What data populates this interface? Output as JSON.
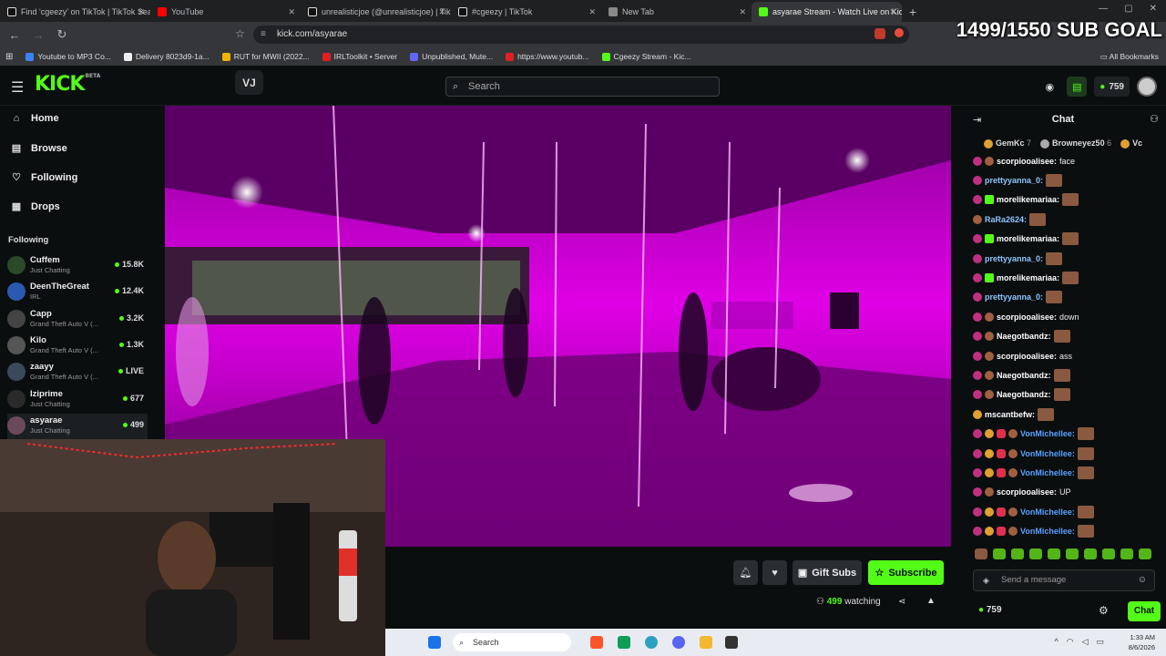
{
  "browser": {
    "tabs": [
      {
        "title": "Find 'cgeezy' on TikTok | TikTok Search",
        "icon": "tiktok-icon"
      },
      {
        "title": "YouTube",
        "icon": "youtube-icon"
      },
      {
        "title": "unrealisticjoe (@unrealisticjoe) | TikTok",
        "icon": "tiktok-icon"
      },
      {
        "title": "#cgeezy | TikTok",
        "icon": "tiktok-icon"
      },
      {
        "title": "New Tab",
        "icon": "chrome-icon"
      },
      {
        "title": "asyarae Stream - Watch Live on Kick",
        "icon": "kick-icon"
      }
    ],
    "url": "kick.com/asyarae",
    "bookmarks": [
      {
        "label": "Youtube to MP3 Co...",
        "color": "#3b82f6"
      },
      {
        "label": "Delivery 8023d9-1a...",
        "color": "#eeeeee"
      },
      {
        "label": "RUT for MWII (2022...",
        "color": "#f0b400"
      },
      {
        "label": "IRLToolkit • Server",
        "color": "#e02020"
      },
      {
        "label": "Unpublished, Mute...",
        "color": "#6366f1"
      },
      {
        "label": "https://www.youtub...",
        "color": "#e02020"
      },
      {
        "label": "Cgeezy Stream - Kic...",
        "color": "#53fc18"
      }
    ],
    "all_bookmarks": "All Bookmarks"
  },
  "overlay": {
    "sub_goal": "1499/1550 SUB GOAL"
  },
  "header": {
    "logo": "KICK",
    "logo_sup": "BETA",
    "search_placeholder": "Search",
    "kicks_count": "759"
  },
  "sidebar": {
    "nav": [
      {
        "label": "Home",
        "icon": "home-icon",
        "glyph": "⌂"
      },
      {
        "label": "Browse",
        "icon": "browse-icon",
        "glyph": "▤"
      },
      {
        "label": "Following",
        "icon": "heart-icon",
        "glyph": "♡"
      },
      {
        "label": "Drops",
        "icon": "drops-icon",
        "glyph": "▦"
      }
    ],
    "following_heading": "Following",
    "following": [
      {
        "name": "Cuffem",
        "category": "Just Chatting",
        "count": "15.8K",
        "color": "#2a4a2a"
      },
      {
        "name": "DeenTheGreat",
        "category": "IRL",
        "count": "12.4K",
        "color": "#2a5ab0"
      },
      {
        "name": "Capp",
        "category": "Grand Theft Auto V (...",
        "count": "3.2K",
        "color": "#444"
      },
      {
        "name": "Kilo",
        "category": "Grand Theft Auto V (...",
        "count": "1.3K",
        "color": "#555"
      },
      {
        "name": "zaayy",
        "category": "Grand Theft Auto V (...",
        "count": "LIVE",
        "color": "#3a4a5a"
      },
      {
        "name": "Iziprime",
        "category": "Just Chatting",
        "count": "677",
        "color": "#2a2a2a"
      },
      {
        "name": "asyarae",
        "category": "Just Chatting",
        "count": "499",
        "color": "#6a4a5a"
      }
    ]
  },
  "stream": {
    "gift_label": "Gift Subs",
    "subscribe_label": "Subscribe",
    "viewers": "499",
    "watching_label": "watching"
  },
  "chat": {
    "title": "Chat",
    "top_gifters": [
      {
        "name": "GemKc",
        "count": "7"
      },
      {
        "name": "Browneyez50",
        "count": "6"
      },
      {
        "name": "Vc",
        "count": ""
      }
    ],
    "messages": [
      {
        "user": "scorpiooalisee:",
        "text": "face",
        "color": "#ffffff",
        "badges": [
          "b-sub",
          "b-hand"
        ],
        "emote": false
      },
      {
        "user": "prettyyanna_0:",
        "text": "",
        "color": "#8ec5ff",
        "badges": [
          "b-sub"
        ],
        "emote": true
      },
      {
        "user": "morelikemariaa:",
        "text": "",
        "color": "#ffffff",
        "badges": [
          "b-sub",
          "b-gift"
        ],
        "emote": true
      },
      {
        "user": "RaRa2624:",
        "text": "",
        "color": "#8ec5ff",
        "badges": [
          "b-hand"
        ],
        "emote": true
      },
      {
        "user": "morelikemariaa:",
        "text": "",
        "color": "#ffffff",
        "badges": [
          "b-sub",
          "b-gift"
        ],
        "emote": true
      },
      {
        "user": "prettyyanna_0:",
        "text": "",
        "color": "#8ec5ff",
        "badges": [
          "b-sub"
        ],
        "emote": true
      },
      {
        "user": "morelikemariaa:",
        "text": "",
        "color": "#ffffff",
        "badges": [
          "b-sub",
          "b-gift"
        ],
        "emote": true
      },
      {
        "user": "prettyyanna_0:",
        "text": "",
        "color": "#8ec5ff",
        "badges": [
          "b-sub"
        ],
        "emote": true
      },
      {
        "user": "scorpiooalisee:",
        "text": "down",
        "color": "#ffffff",
        "badges": [
          "b-sub",
          "b-hand"
        ],
        "emote": false
      },
      {
        "user": "Naegotbandz:",
        "text": "",
        "color": "#ffffff",
        "badges": [
          "b-sub",
          "b-hand"
        ],
        "emote": true
      },
      {
        "user": "scorpiooalisee:",
        "text": "ass",
        "color": "#ffffff",
        "badges": [
          "b-sub",
          "b-hand"
        ],
        "emote": false
      },
      {
        "user": "Naegotbandz:",
        "text": "",
        "color": "#ffffff",
        "badges": [
          "b-sub",
          "b-hand"
        ],
        "emote": true
      },
      {
        "user": "Naegotbandz:",
        "text": "",
        "color": "#ffffff",
        "badges": [
          "b-sub",
          "b-hand"
        ],
        "emote": true
      },
      {
        "user": "mscantbefw:",
        "text": "",
        "color": "#ffffff",
        "badges": [
          "b-og"
        ],
        "emote": true
      },
      {
        "user": "VonMichellee:",
        "text": "",
        "color": "#5aa0ff",
        "badges": [
          "b-sub",
          "b-og",
          "b-vip",
          "b-hand"
        ],
        "emote": true
      },
      {
        "user": "VonMichellee:",
        "text": "",
        "color": "#5aa0ff",
        "badges": [
          "b-sub",
          "b-og",
          "b-vip",
          "b-hand"
        ],
        "emote": true
      },
      {
        "user": "VonMichellee:",
        "text": "",
        "color": "#5aa0ff",
        "badges": [
          "b-sub",
          "b-og",
          "b-vip",
          "b-hand"
        ],
        "emote": true
      },
      {
        "user": "scorpiooalisee:",
        "text": "UP",
        "color": "#ffffff",
        "badges": [
          "b-sub",
          "b-hand"
        ],
        "emote": false
      },
      {
        "user": "VonMichellee:",
        "text": "",
        "color": "#5aa0ff",
        "badges": [
          "b-sub",
          "b-og",
          "b-vip",
          "b-hand"
        ],
        "emote": true
      },
      {
        "user": "VonMichellee:",
        "text": "",
        "color": "#5aa0ff",
        "badges": [
          "b-sub",
          "b-og",
          "b-vip",
          "b-hand"
        ],
        "emote": true
      }
    ],
    "input_placeholder": "Send a message",
    "kicks_count": "759",
    "send_label": "Chat"
  },
  "taskbar": {
    "search_label": "Search",
    "time": "1:33 AM",
    "date": "8/6/2026"
  },
  "colors": {
    "accent": "#53fc18",
    "background": "#0b0e0f"
  }
}
